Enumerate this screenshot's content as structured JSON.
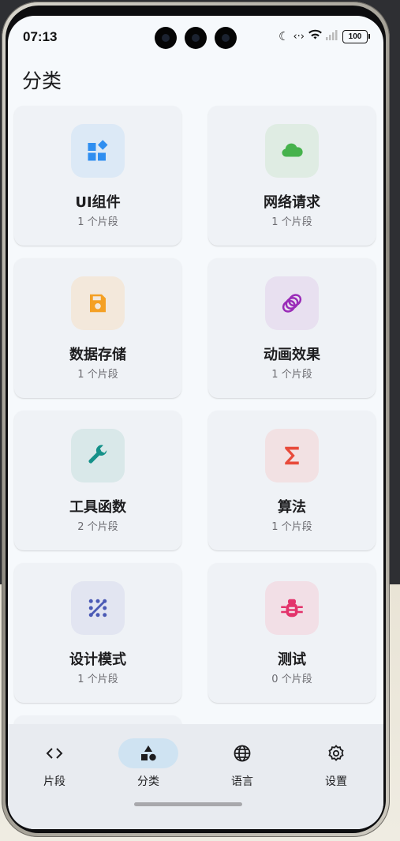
{
  "status_bar": {
    "time": "07:13",
    "battery": "100"
  },
  "page_title": "分类",
  "categories": [
    {
      "name": "UI组件",
      "count": "1 个片段",
      "icon": "widgets-icon",
      "color": "#2f8ef0",
      "tile": "#dce9f6"
    },
    {
      "name": "网络请求",
      "count": "1 个片段",
      "icon": "cloud-icon",
      "color": "#46b24c",
      "tile": "#dfece3"
    },
    {
      "name": "数据存储",
      "count": "1 个片段",
      "icon": "save-icon",
      "color": "#f4a024",
      "tile": "#f3e8db"
    },
    {
      "name": "动画效果",
      "count": "1 个片段",
      "icon": "rings-icon",
      "color": "#9a2bb8",
      "tile": "#e8e0f0"
    },
    {
      "name": "工具函数",
      "count": "2 个片段",
      "icon": "wrench-icon",
      "color": "#159189",
      "tile": "#d9e8e9"
    },
    {
      "name": "算法",
      "count": "1 个片段",
      "icon": "sigma-icon",
      "color": "#e84a3b",
      "tile": "#f2e1e3"
    },
    {
      "name": "设计模式",
      "count": "1 个片段",
      "icon": "pattern-icon",
      "color": "#4b5ab5",
      "tile": "#e2e5f1"
    },
    {
      "name": "测试",
      "count": "0 个片段",
      "icon": "bug-icon",
      "color": "#e3336b",
      "tile": "#f2dfe6"
    }
  ],
  "bottom_nav": [
    {
      "label": "片段",
      "icon": "code-icon",
      "active": false
    },
    {
      "label": "分类",
      "icon": "category-icon",
      "active": true
    },
    {
      "label": "语言",
      "icon": "globe-icon",
      "active": false
    },
    {
      "label": "设置",
      "icon": "gear-icon",
      "active": false
    }
  ]
}
